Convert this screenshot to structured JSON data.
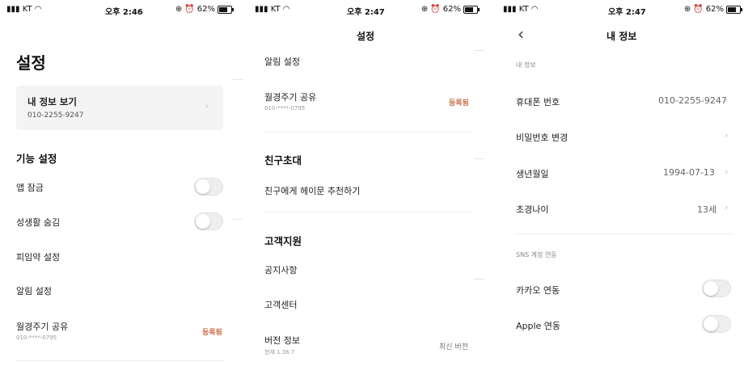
{
  "status_bars": [
    {
      "carrier": "KT",
      "time": "오후 2:46",
      "battery": "62%"
    },
    {
      "carrier": "KT",
      "time": "오후 2:47",
      "battery": "62%"
    },
    {
      "carrier": "KT",
      "time": "오후 2:47",
      "battery": "62%"
    }
  ],
  "screen1": {
    "title": "설정",
    "profile_card": {
      "label": "내 정보 보기",
      "phone": "010-2255-9247"
    },
    "feature_section": "기능 설정",
    "items": {
      "app_lock": "앱 잠금",
      "hide_sex_life": "성생활 숨김",
      "pill_settings": "피임약 설정",
      "notification_settings": "알림 설정",
      "cycle_share": "월경주기 공유",
      "cycle_share_phone": "010-****-0795",
      "cycle_share_status": "등록됨"
    },
    "toggles": {
      "app_lock": false,
      "hide_sex_life": false
    }
  },
  "screen2": {
    "nav_title": "설정",
    "items": {
      "notification_settings": "알림 설정",
      "cycle_share": "월경주기 공유",
      "cycle_share_phone": "010-****-0795",
      "cycle_share_status": "등록됨"
    },
    "invite_section": "친구초대",
    "invite_item": "친구에게 헤이문 추천하기",
    "support_section": "고객지원",
    "notice": "공지사항",
    "customer_center": "고객센터",
    "version_label": "버전 정보",
    "version_current": "현재 1.36.7",
    "version_status": "최신 버전"
  },
  "screen3": {
    "nav_title": "내 정보",
    "back_icon": "chevron-left-icon",
    "my_info_label": "내 정보",
    "rows": {
      "phone_label": "휴대폰 번호",
      "phone_value": "010-2255-9247",
      "password_label": "비밀번호 변경",
      "birth_label": "생년월일",
      "birth_value": "1994-07-13",
      "menarche_label": "초경나이",
      "menarche_value": "13세"
    },
    "sns_label": "SNS 계정 연동",
    "kakao_label": "카카오 연동",
    "apple_label": "Apple 연동",
    "toggles": {
      "kakao": false,
      "apple": false
    }
  },
  "colors": {
    "accent": "#c8704a",
    "toggle_off": "#eeeeee",
    "card_bg": "#f4f4f4"
  }
}
